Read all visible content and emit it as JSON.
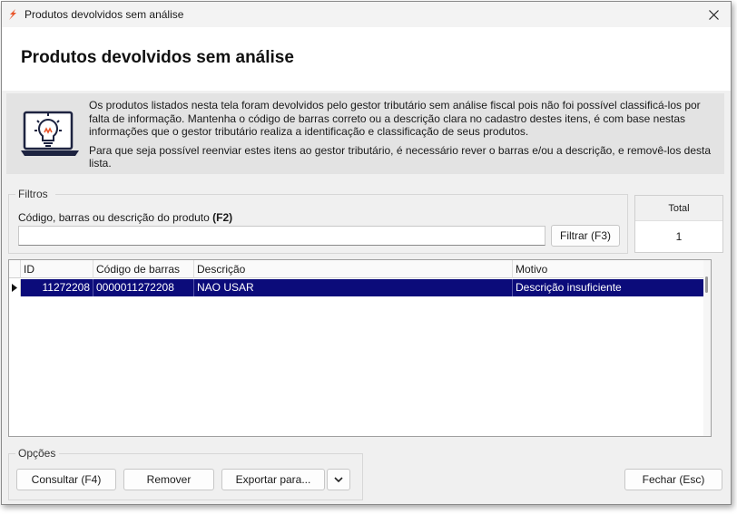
{
  "window": {
    "title": "Produtos devolvidos sem análise"
  },
  "header": {
    "title": "Produtos devolvidos sem análise"
  },
  "info": {
    "paragraph1": "Os produtos listados nesta tela foram devolvidos pelo gestor tributário sem análise fiscal pois não foi possível classificá-los por falta de informação. Mantenha o código de barras correto ou a descrição clara no cadastro destes itens, é com base nestas informações que o gestor tributário realiza a identificação e classificação de seus produtos.",
    "paragraph2": "Para que seja possível reenviar estes itens ao gestor tributário, é necessário rever o barras e/ou a descrição, e removê-los desta lista."
  },
  "filters": {
    "legend": "Filtros",
    "label": "Código, barras ou descrição do produto",
    "shortcut": "(F2)",
    "search_value": "",
    "filter_button": "Filtrar (F3)"
  },
  "total": {
    "label": "Total",
    "value": "1"
  },
  "grid": {
    "columns": [
      "ID",
      "Código de barras",
      "Descrição",
      "Motivo"
    ],
    "rows": [
      {
        "id": "11272208",
        "barcode": "0000011272208",
        "description": "NAO USAR",
        "reason": "Descrição insuficiente"
      }
    ]
  },
  "options": {
    "legend": "Opções",
    "consult_button": "Consultar (F4)",
    "remove_button": "Remover",
    "export_button": "Exportar para...",
    "close_button": "Fechar (Esc)"
  },
  "icons": {
    "app": "app-logo-icon",
    "close": "close-icon",
    "banner": "lightbulb-laptop-icon",
    "dropdown": "chevron-down-icon",
    "row_indicator": "row-pointer-icon"
  },
  "colors": {
    "selection": "#0b0b7a",
    "banner_bg": "#e3e3e3",
    "window_bg": "#f0f0f0",
    "brand_orange": "#e8542a"
  }
}
